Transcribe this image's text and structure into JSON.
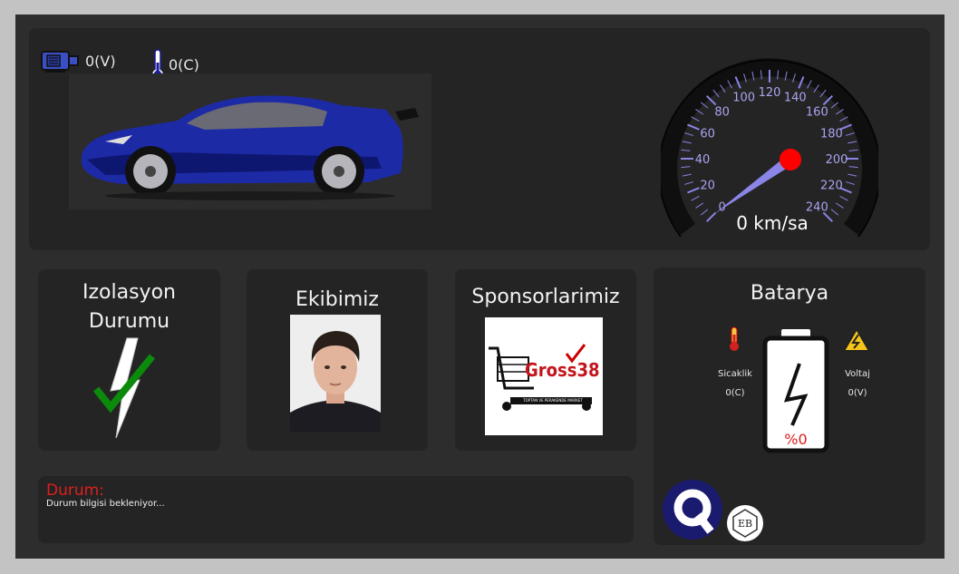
{
  "header": {
    "motor_voltage": "0(V)",
    "motor_temp": "0(C)"
  },
  "speedometer": {
    "ticks": [
      "0",
      "20",
      "40",
      "60",
      "80",
      "100",
      "120",
      "140",
      "160",
      "180",
      "200",
      "220",
      "240"
    ],
    "readout": "0 km/sa",
    "speed": 0,
    "max": 240
  },
  "isolation": {
    "title_line1": "Izolasyon",
    "title_line2": "Durumu"
  },
  "team": {
    "title": "Ekibimiz"
  },
  "sponsors": {
    "title": "Sponsorlarimiz",
    "logo_text": "Gross",
    "logo_num": "38",
    "logo_tagline": "TOPTAN VE PERAKENDE MARKET"
  },
  "battery": {
    "title": "Batarya",
    "temp_label": "Sicaklik",
    "temp_value": "0(C)",
    "voltage_label": "Voltaj",
    "voltage_value": "0(V)",
    "charge": "%0"
  },
  "status": {
    "label": "Durum:",
    "text": "Durum bilgisi bekleniyor..."
  },
  "logos": {
    "eb": "EB"
  },
  "colors": {
    "panel": "#242424",
    "gauge_accent": "#8a85e6",
    "alert": "#e01e1e"
  }
}
